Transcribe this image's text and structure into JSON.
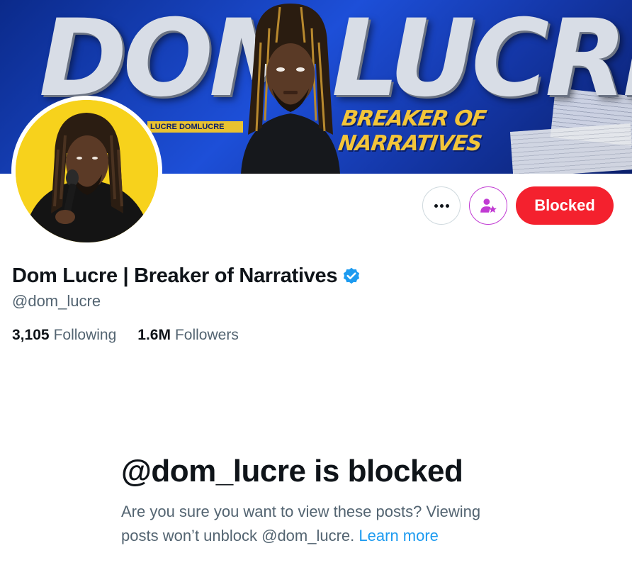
{
  "banner": {
    "title_left": "DOM",
    "title_right": "LUCRE",
    "tagline": "BREAKER OF NARRATIVES",
    "handles": "LUCRE  DOMLUCRE"
  },
  "profile": {
    "display_name": "Dom Lucre | Breaker of Narratives",
    "handle": "@dom_lucre",
    "verified_icon": "verified-badge-icon",
    "verified_color": "#1d9bf0",
    "following_count": "3,105",
    "following_label": "Following",
    "followers_count": "1.6M",
    "followers_label": "Followers"
  },
  "actions": {
    "more_icon": "more-dots-icon",
    "subscribe_icon": "user-star-icon",
    "subscribe_color": "#c13bd3",
    "blocked_label": "Blocked",
    "blocked_color": "#f4212e"
  },
  "blocked_notice": {
    "title": "@dom_lucre is blocked",
    "desc": "Are you sure you want to view these posts? Viewing posts won’t unblock @dom_lucre.",
    "learn_more": "Learn more"
  }
}
